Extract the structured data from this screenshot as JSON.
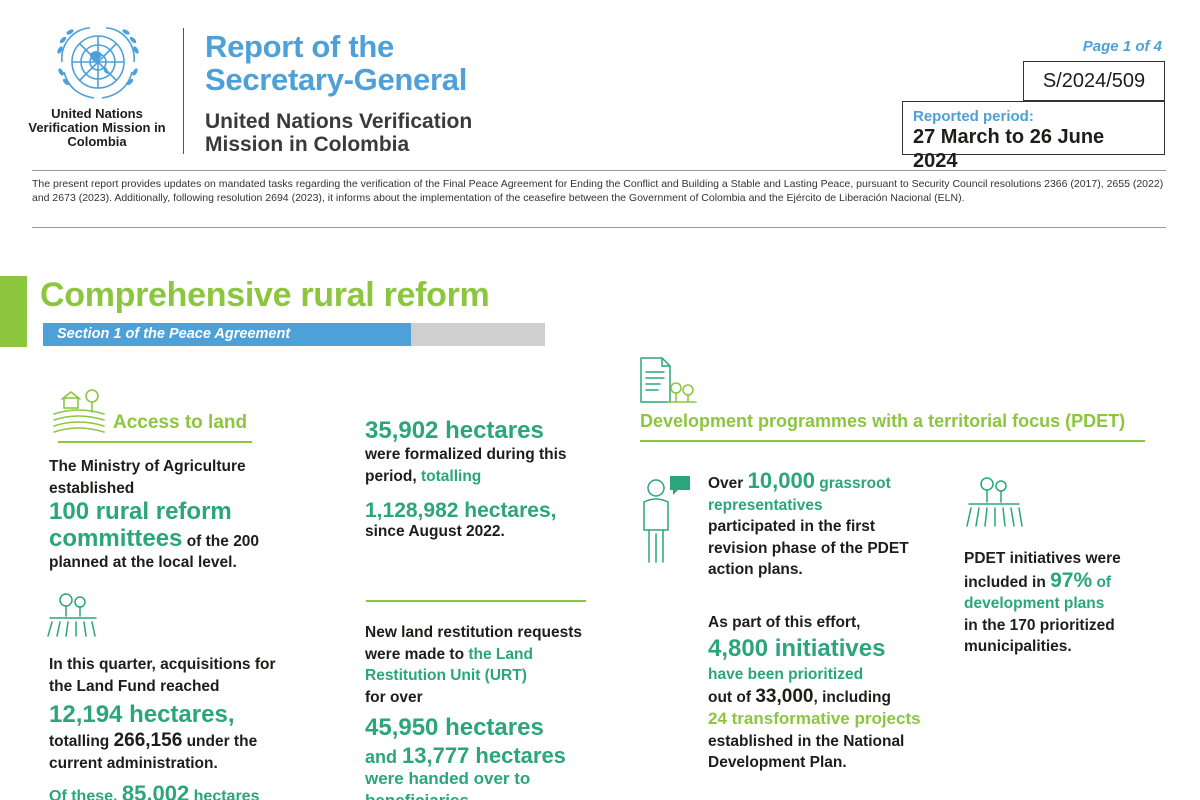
{
  "header": {
    "org_name": "United Nations Verification Mission in Colombia",
    "title_line1": "Report of the",
    "title_line2": "Secretary-General",
    "mission_line1": "United Nations Verification",
    "mission_line2": "Mission in Colombia",
    "page_label": "Page 1 of 4",
    "doc_symbol": "S/2024/509",
    "period_label": "Reported period:",
    "period_value": "27 March to 26 June 2024"
  },
  "intro": "The present report provides updates on mandated tasks regarding the verification of the Final Peace Agreement for Ending the Conflict and Building a Stable and Lasting Peace, pursuant to Security Council resolutions 2366 (2017), 2655 (2022) and 2673 (2023). Additionally, following resolution 2694 (2023), it informs about the implementation of the ceasefire between the Government of Colombia and the Ejército de Liberación Nacional (ELN).",
  "section": {
    "title": "Comprehensive rural reform",
    "subtitle": "Section 1 of the Peace Agreement"
  },
  "access": {
    "heading": "Access to land",
    "p1_a": "The Ministry of Agriculture established",
    "p1_big": "100 rural reform committees",
    "p1_b": " of the 200 planned at the local level.",
    "p2_green": "In this quarter, acquisitions for the Land Fund reached",
    "p2_big": "12,194 hectares",
    "p2_comma": ",",
    "p2_b": "totalling ",
    "p2_b_bold": "266,156",
    "p2_c": " under the current administration.",
    "p3_green": "Of these, ",
    "p3_big": "85,002",
    "p3_c": " hectares"
  },
  "formalized": {
    "big": "35,902 hectares",
    "a": "were formalized during this period, ",
    "a_green": "totalling",
    "total": "1,128,982 hectares,",
    "since": "since August 2022."
  },
  "restitution": {
    "a": "New land restitution requests were made to ",
    "a_green": "the Land Restitution Unit (URT)",
    "b": "for over",
    "big1": "45,950 hectares",
    "and": "and ",
    "big2": "13,777 hectares",
    "c": "were handed over to",
    "d": "beneficiaries."
  },
  "pdet": {
    "heading": "Development programmes with a territorial focus (PDET)",
    "p1_over": "Over ",
    "p1_num": "10,000",
    "p1_green": " grassroot representatives",
    "p1_rest": "participated in the first revision phase of the PDET action plans.",
    "p2_a": "As part of this effort,",
    "p2_big": "4,800 initiatives",
    "p2_green": "have been prioritized",
    "p2_b": "out of ",
    "p2_b_bold": "33,000",
    "p2_c": ", including",
    "p2_lgreen": "24 transformative projects",
    "p2_d": " established in the National Development Plan.",
    "p3_a": "PDET initiatives were included in ",
    "p3_pct": "97%",
    "p3_green": " of development plans",
    "p3_b": "in the 170 prioritized municipalities."
  },
  "colors": {
    "blue": "#4da0d8",
    "green": "#8cc63f",
    "teal": "#2aa57c",
    "grey": "#cfcfcf"
  },
  "icons": [
    "un-emblem-icon",
    "farm-field-icon",
    "tree-field-icon",
    "document-trees-icon",
    "person-speech-icon",
    "tree-field-icon-2"
  ]
}
